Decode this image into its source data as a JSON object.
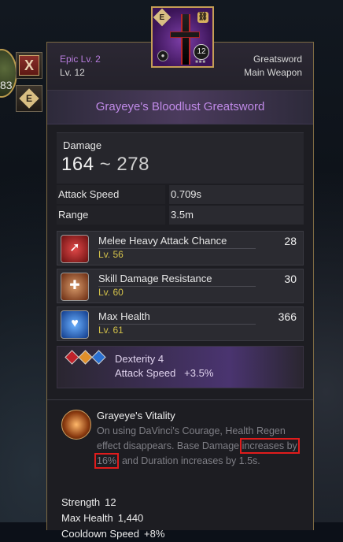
{
  "side": {
    "badge_number": "83",
    "close_label": "X",
    "equip_label": "E"
  },
  "item_icon": {
    "badge_e": "E",
    "badge_link": "⛓",
    "badge_lock": "🔒",
    "badge_level": "12"
  },
  "header": {
    "tier": "Epic Lv. 2",
    "level": "Lv. 12",
    "weapon_type": "Greatsword",
    "slot": "Main Weapon"
  },
  "title": "Grayeye's Bloodlust Greatsword",
  "damage": {
    "label": "Damage",
    "min": "164",
    "sep": "~",
    "max": "278"
  },
  "stats": [
    {
      "label": "Attack Speed",
      "value": "0.709s"
    },
    {
      "label": "Range",
      "value": "3.5m"
    }
  ],
  "options": [
    {
      "name": "Melee Heavy Attack Chance",
      "level": "Lv. 56",
      "value": "28",
      "icon": "melee-heavy-attack-icon",
      "color": "#c0222a"
    },
    {
      "name": "Skill Damage Resistance",
      "level": "Lv. 60",
      "value": "30",
      "icon": "skill-resistance-icon",
      "color": "#d06a30"
    },
    {
      "name": "Max Health",
      "level": "Lv. 61",
      "value": "366",
      "icon": "max-health-icon",
      "color": "#2a70d0"
    }
  ],
  "gem_bonus": {
    "line1": "Dexterity 4",
    "line2": "Attack Speed   +3.5%"
  },
  "set": {
    "title": "Grayeye's Vitality",
    "desc_before": "On using DaVinci's Courage, Health Regen effect disappears. Base Damage ",
    "desc_highlight": "increases by 16%",
    "desc_after": ", and Duration increases by 1.5s."
  },
  "bonus_stats": [
    {
      "label": "Strength",
      "value": "12"
    },
    {
      "label": "Max Health",
      "value": "1,440"
    },
    {
      "label": "Cooldown Speed",
      "value": "+8%"
    }
  ],
  "colors": {
    "epic": "#b77cdd",
    "title": "#c08ae8",
    "level": "#d4c24a",
    "highlight": "#e01c1c",
    "frame": "#7d6a43"
  }
}
